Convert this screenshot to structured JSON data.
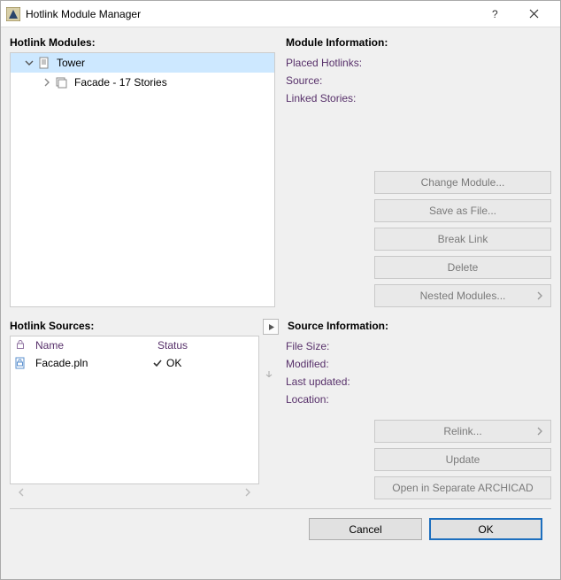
{
  "window": {
    "title": "Hotlink Module Manager"
  },
  "modules": {
    "section_label": "Hotlink Modules:",
    "tree": [
      {
        "label": "Tower",
        "indent": 0,
        "expanded": true,
        "selected": true,
        "icon": "doc"
      },
      {
        "label": "Facade - 17 Stories",
        "indent": 1,
        "expanded": false,
        "selected": false,
        "icon": "stack"
      }
    ]
  },
  "module_info": {
    "section_label": "Module Information:",
    "rows": {
      "placed": "Placed Hotlinks:",
      "source": "Source:",
      "linked": "Linked Stories:"
    },
    "buttons": {
      "change": "Change Module...",
      "save_as": "Save as File...",
      "break": "Break Link",
      "delete": "Delete",
      "nested": "Nested Modules..."
    }
  },
  "sources": {
    "section_label": "Hotlink Sources:",
    "columns": {
      "name": "Name",
      "status": "Status"
    },
    "rows": [
      {
        "name": "Facade.pln",
        "status": "OK"
      }
    ]
  },
  "source_info": {
    "section_label": "Source Information:",
    "rows": {
      "filesize": "File Size:",
      "modified": "Modified:",
      "lastupdated": "Last updated:",
      "location": "Location:"
    },
    "buttons": {
      "relink": "Relink...",
      "update": "Update",
      "open": "Open in Separate ARCHICAD"
    }
  },
  "footer": {
    "cancel": "Cancel",
    "ok": "OK"
  }
}
